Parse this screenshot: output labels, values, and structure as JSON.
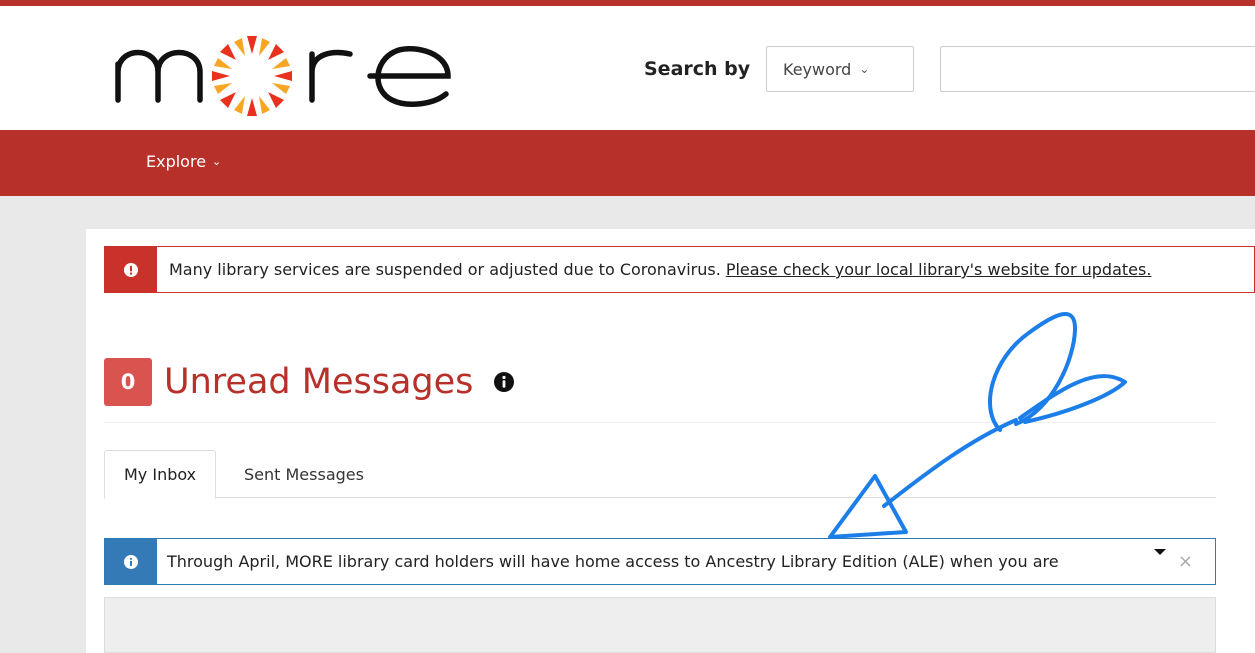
{
  "header": {
    "logo_text": "more",
    "search_by_label": "Search by",
    "search_type_selected": "Keyword",
    "search_input_value": "",
    "colors": {
      "brand_red": "#b7302a",
      "logo_orange": "#f08a24"
    }
  },
  "nav": {
    "explore_label": "Explore"
  },
  "covid_alert": {
    "text": "Many library services are suspended or adjusted due to Coronavirus.",
    "link_text": "Please check your local library's website for updates."
  },
  "messages": {
    "unread_count": "0",
    "title": "Unread Messages",
    "tabs": [
      {
        "label": "My Inbox",
        "active": true
      },
      {
        "label": "Sent Messages",
        "active": false
      }
    ]
  },
  "info_alert": {
    "text": "Through April, MORE library card holders will have home access to Ancestry Library Edition (ALE) when you are",
    "close_symbol": "×"
  },
  "icons": {
    "alert_danger": "exclamation-icon",
    "alert_info": "info-icon",
    "heading_info": "info-icon",
    "annotation": "hand-drawn-arrow"
  }
}
